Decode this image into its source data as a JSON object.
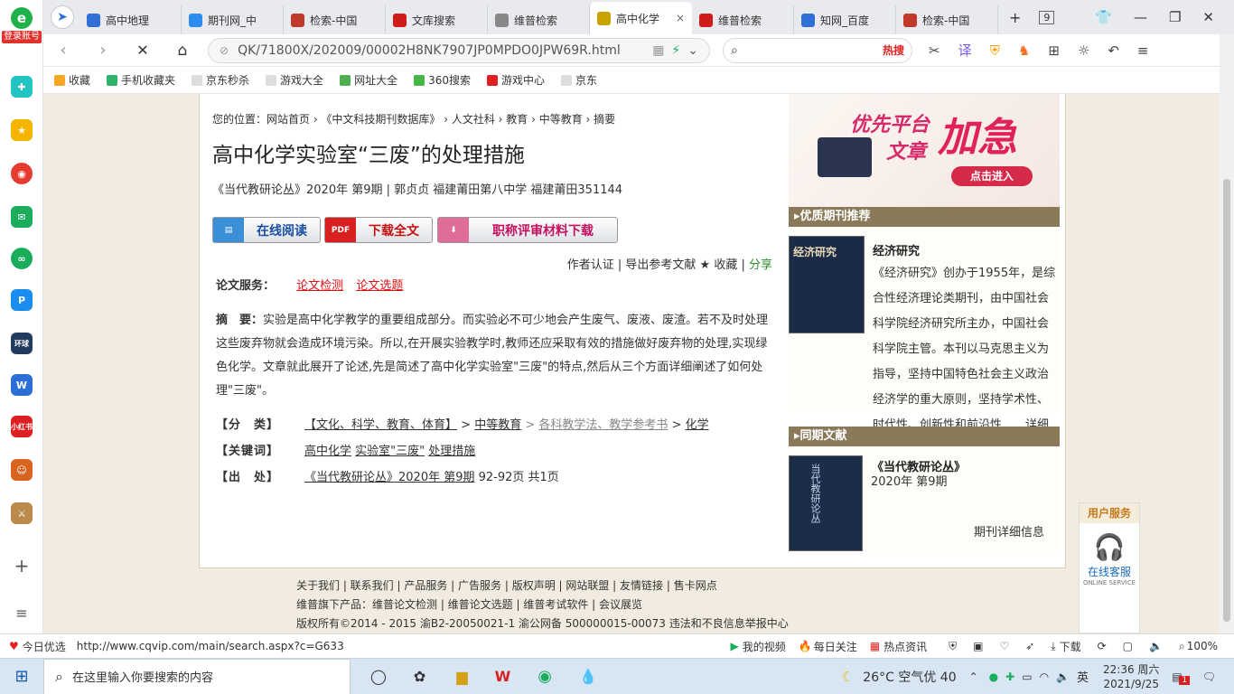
{
  "browser": {
    "login_label": "登录账号",
    "tabs": [
      {
        "title": "高中地理",
        "color": "#2f6fd6",
        "active": false
      },
      {
        "title": "期刊网_中",
        "color": "#2d8cf0",
        "active": false
      },
      {
        "title": "检索-中国",
        "color": "#c0392b",
        "active": false
      },
      {
        "title": "文库搜索",
        "color": "#d11a1a",
        "active": false
      },
      {
        "title": "维普检索",
        "color": "#888888",
        "active": false
      },
      {
        "title": "高中化学",
        "color": "#c8a200",
        "active": true
      },
      {
        "title": "维普检索",
        "color": "#d11a1a",
        "active": false
      },
      {
        "title": "知网_百度",
        "color": "#2f6fd6",
        "active": false
      },
      {
        "title": "检索-中国",
        "color": "#c0392b",
        "active": false
      }
    ],
    "tab_close": "×",
    "tab_add": "+",
    "tab_count": "9",
    "url": "QK/71800X/202009/00002H8NK7907JP0MPDO0JPW69R.html",
    "search_hot": "热搜",
    "bookmarks": [
      {
        "label": "收藏",
        "color": "#f5a623"
      },
      {
        "label": "手机收藏夹",
        "color": "#2fb36b"
      },
      {
        "label": "京东秒杀",
        "color": "#dddddd"
      },
      {
        "label": "游戏大全",
        "color": "#dddddd"
      },
      {
        "label": "网址大全",
        "color": "#4caf50"
      },
      {
        "label": "360搜索",
        "color": "#46b649"
      },
      {
        "label": "游戏中心",
        "color": "#e02020"
      },
      {
        "label": "京东",
        "color": "#dddddd"
      }
    ]
  },
  "article": {
    "breadcrumb": "您的位置：网站首页 › 《中文科技期刊数据库》 › 人文社科 › 教育 › 中等教育 › 摘要",
    "title": "高中化学实验室“三废”的处理措施",
    "subtitle": "《当代教研论丛》2020年 第9期 | 郭贞贞   福建莆田第八中学 福建莆田351144",
    "btn_read": "在线阅读",
    "btn_download": "下载全文",
    "btn_title_material": "职称评审材料下载",
    "tool_author": "作者认证",
    "tool_sep1": " | ",
    "tool_export": "导出参考文献",
    "tool_collect": " ★ 收藏",
    "tool_sep2": " | ",
    "tool_share": "分享",
    "service_label": "论文服务：",
    "service_check": "论文检测",
    "service_topic": "论文选题",
    "abstract_label": "摘　要：",
    "abstract_text": "实验是高中化学教学的重要组成部分。而实验必不可少地会产生废气、废液、废渣。若不及时处理这些废弃物就会造成环境污染。所以,在开展实验教学时,教师还应采取有效的措施做好废弃物的处理,实现绿色化学。文章就此展开了论述,先是简述了高中化学实验室\"三废\"的特点,然后从三个方面详细阐述了如何处理\"三废\"。",
    "class_label": "【分　类】",
    "class_1": "【文化、科学、教育、体育】",
    "class_sep1": " > ",
    "class_2": "中等教育",
    "class_sep2": " > ",
    "class_3": "各科教学法、教学参考书",
    "class_sep3": " > ",
    "class_4": "化学",
    "kw_label": "【关键词】",
    "kw_1": "高中化学",
    "kw_2": "实验室\"三废\"",
    "kw_3": "处理措施",
    "src_label": "【出　处】",
    "src_link": "《当代教研论丛》2020年 第9期",
    "src_pages": " 92-92页 共1页"
  },
  "sidebar_right": {
    "ad_line1": "优先平台",
    "ad_line2": "文章",
    "ad_big": "加急",
    "ad_btn": "点击进入",
    "rec_header": "优质期刊推荐",
    "rec_name": "经济研究",
    "rec_desc": "《经济研究》创办于1955年，是综合性经济理论类期刊，由中国社会科学院经济研究所主办，中国社会科学院主管。本刊以马克思主义为指导，坚持中国特色社会主义政治经济学的重大原则，坚持学术性、时代性、创新性和前沿性……详细",
    "rec_cover": "经济研究",
    "same_header": "同期文献",
    "same_name": "《当代教研论丛》",
    "same_issue": "2020年 第9期",
    "same_more": "期刊详细信息",
    "same_cover": "当代教研论丛"
  },
  "footer": {
    "line1": "关于我们 | 联系我们 | 产品服务 | 广告服务 | 版权声明 | 网站联盟 | 友情链接 | 售卡网点",
    "line2": "维普旗下产品：维普论文检测 | 维普论文选题 | 维普考试软件 | 会议展览",
    "line3": "版权所有©2014 - 2015 渝B2-20050021-1   渝公网备 500000015-00073   违法和不良信息举报中心"
  },
  "user_service": {
    "header": "用户服务",
    "label": "在线客服",
    "sub": "ONLINE SERVICE"
  },
  "statusbar": {
    "today": "今日优选",
    "url": "http://www.cqvip.com/main/search.aspx?c=G633",
    "video": "我的视频",
    "daily": "每日关注",
    "news": "热点资讯",
    "download": "下载",
    "zoom": "100%"
  },
  "taskbar": {
    "search_placeholder": "在这里输入你要搜索的内容",
    "weather": "26°C 空气优 40",
    "lang": "英",
    "time": "22:36 周六",
    "date": "2021/9/25",
    "notif": "1"
  }
}
